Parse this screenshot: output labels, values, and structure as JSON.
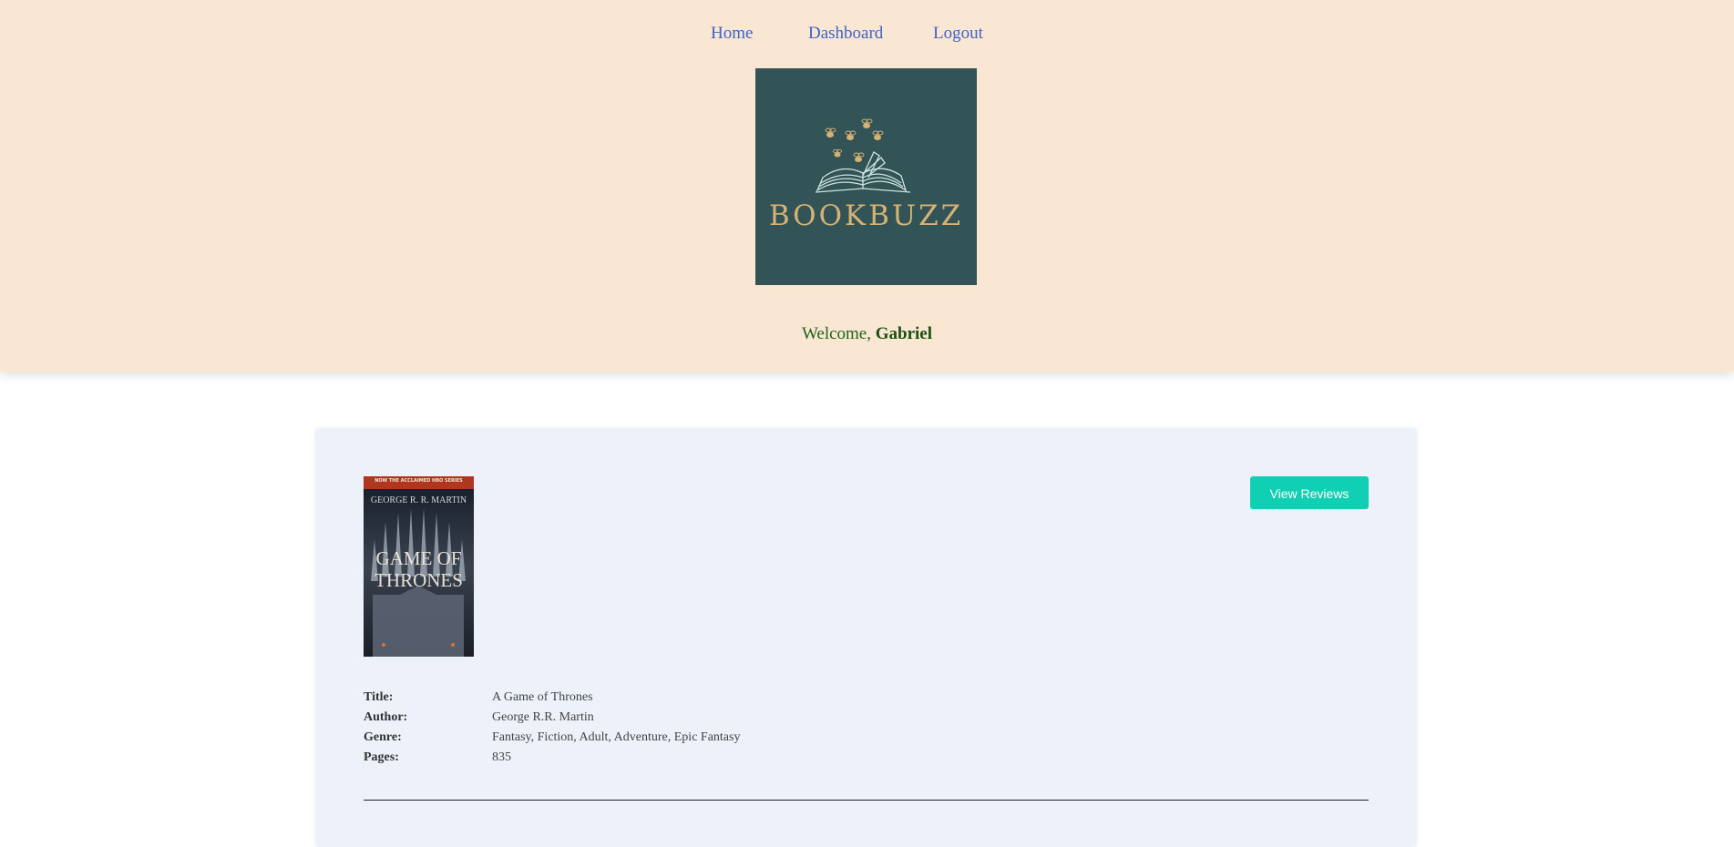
{
  "nav": {
    "home": "Home",
    "dashboard": "Dashboard",
    "logout": "Logout"
  },
  "logo": {
    "text": "BOOKBUZZ",
    "bg_color": "#325457",
    "accent_color": "#d6b274"
  },
  "welcome": {
    "prefix": "Welcome, ",
    "user": "Gabriel"
  },
  "book": {
    "cover": {
      "banner": "NOW THE ACCLAIMED HBO SERIES",
      "author": "GEORGE R. R. MARTIN",
      "title_line1": "GAME OF",
      "title_line2": "THRONES"
    },
    "view_reviews_label": "View Reviews",
    "fields": [
      {
        "label": "Title:",
        "value": "A Game of Thrones"
      },
      {
        "label": "Author:",
        "value": "George R.R. Martin"
      },
      {
        "label": "Genre:",
        "value": "Fantasy, Fiction, Adult, Adventure, Epic Fantasy"
      },
      {
        "label": "Pages:",
        "value": "835"
      }
    ]
  },
  "colors": {
    "header_bg": "#fae7d3",
    "nav_link": "#3e63c9",
    "card_bg": "#edf1fa",
    "button_bg": "#10cfb2",
    "welcome_text": "#1f6318"
  }
}
